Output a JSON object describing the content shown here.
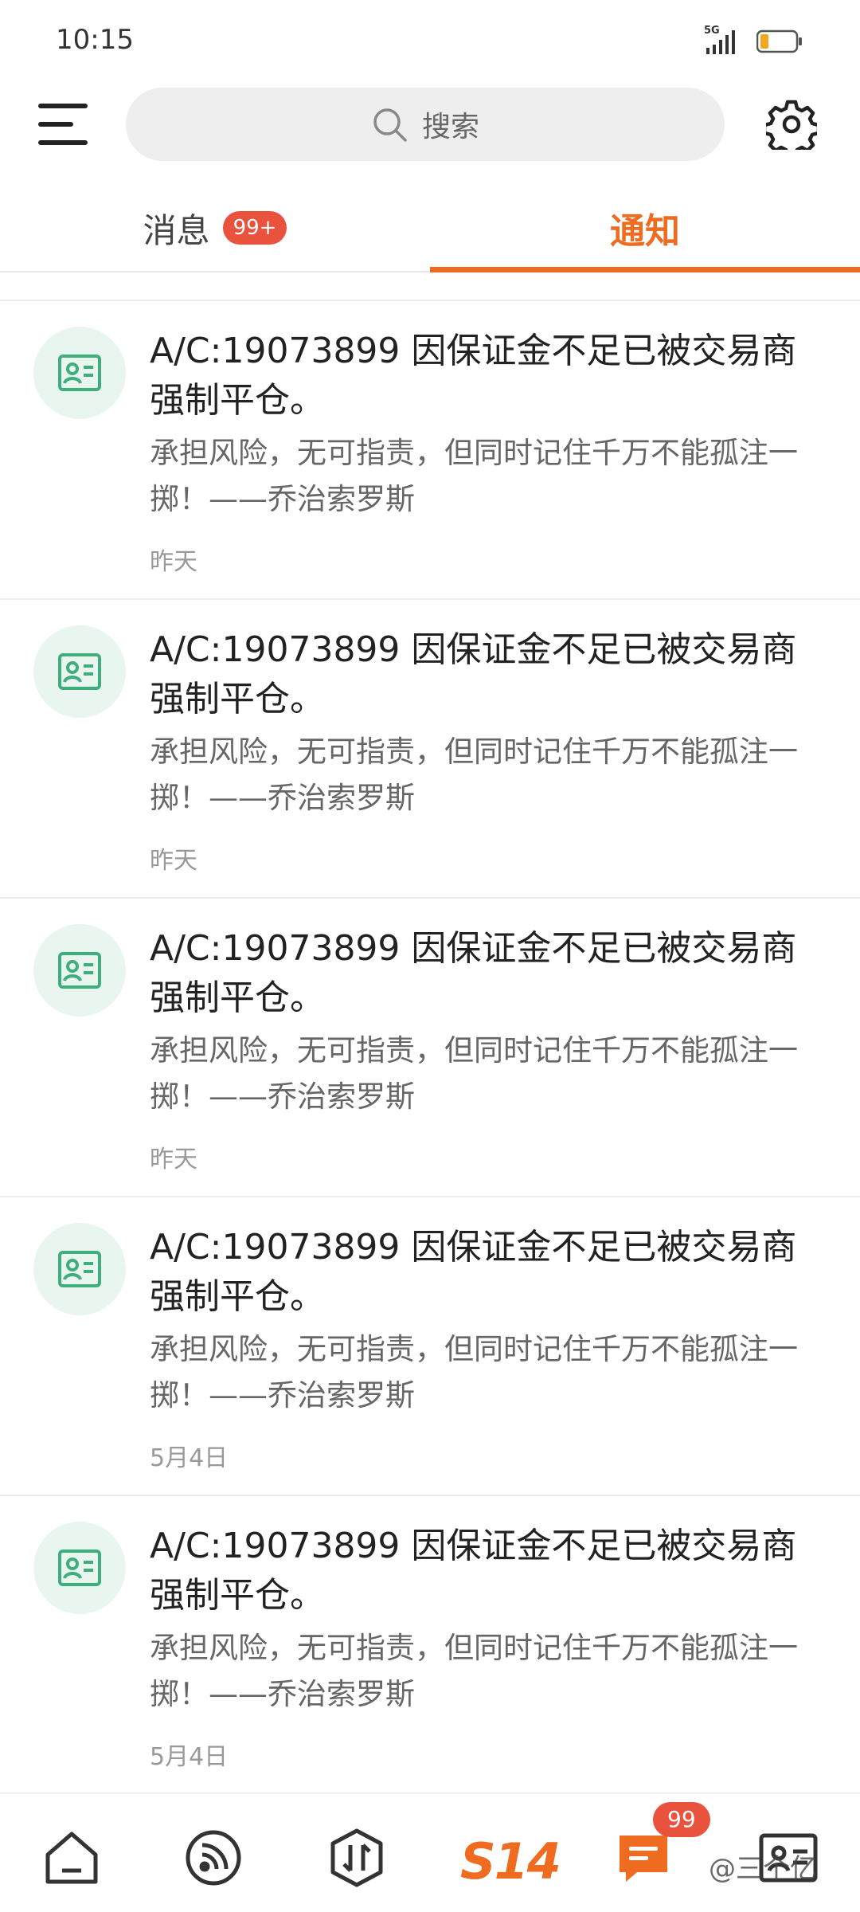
{
  "status_bar": {
    "time": "10:15",
    "network": "5G"
  },
  "search": {
    "placeholder": "搜索"
  },
  "tabs": [
    {
      "label": "消息",
      "badge": "99+",
      "active": false
    },
    {
      "label": "通知",
      "active": true
    }
  ],
  "notifications": [
    {
      "title": "A/C:19073899  因保证金不足已被交易商强制平仓。",
      "body": "承担风险，无可指责，但同时记住千万不能孤注一掷！——乔治索罗斯",
      "time": "昨天"
    },
    {
      "title": "A/C:19073899  因保证金不足已被交易商强制平仓。",
      "body": "承担风险，无可指责，但同时记住千万不能孤注一掷！——乔治索罗斯",
      "time": "昨天"
    },
    {
      "title": "A/C:19073899  因保证金不足已被交易商强制平仓。",
      "body": "承担风险，无可指责，但同时记住千万不能孤注一掷！——乔治索罗斯",
      "time": "昨天"
    },
    {
      "title": "A/C:19073899  因保证金不足已被交易商强制平仓。",
      "body": "承担风险，无可指责，但同时记住千万不能孤注一掷！——乔治索罗斯",
      "time": "5月4日"
    },
    {
      "title": "A/C:19073899  因保证金不足已被交易商强制平仓。",
      "body": "承担风险，无可指责，但同时记住千万不能孤注一掷！——乔治索罗斯",
      "time": "5月4日"
    }
  ],
  "bottom_nav": {
    "items": [
      "home-icon",
      "feed-icon",
      "trade-icon",
      "s14-logo",
      "messages-icon",
      "profile-card-icon"
    ],
    "logo_text": "S14",
    "messages_badge": "99",
    "watermark": "@三个亿"
  },
  "colors": {
    "accent": "#ee6b1f",
    "badge": "#e9533d",
    "avatar_bg": "#e8f6ef",
    "avatar_icon": "#3fae7c"
  }
}
